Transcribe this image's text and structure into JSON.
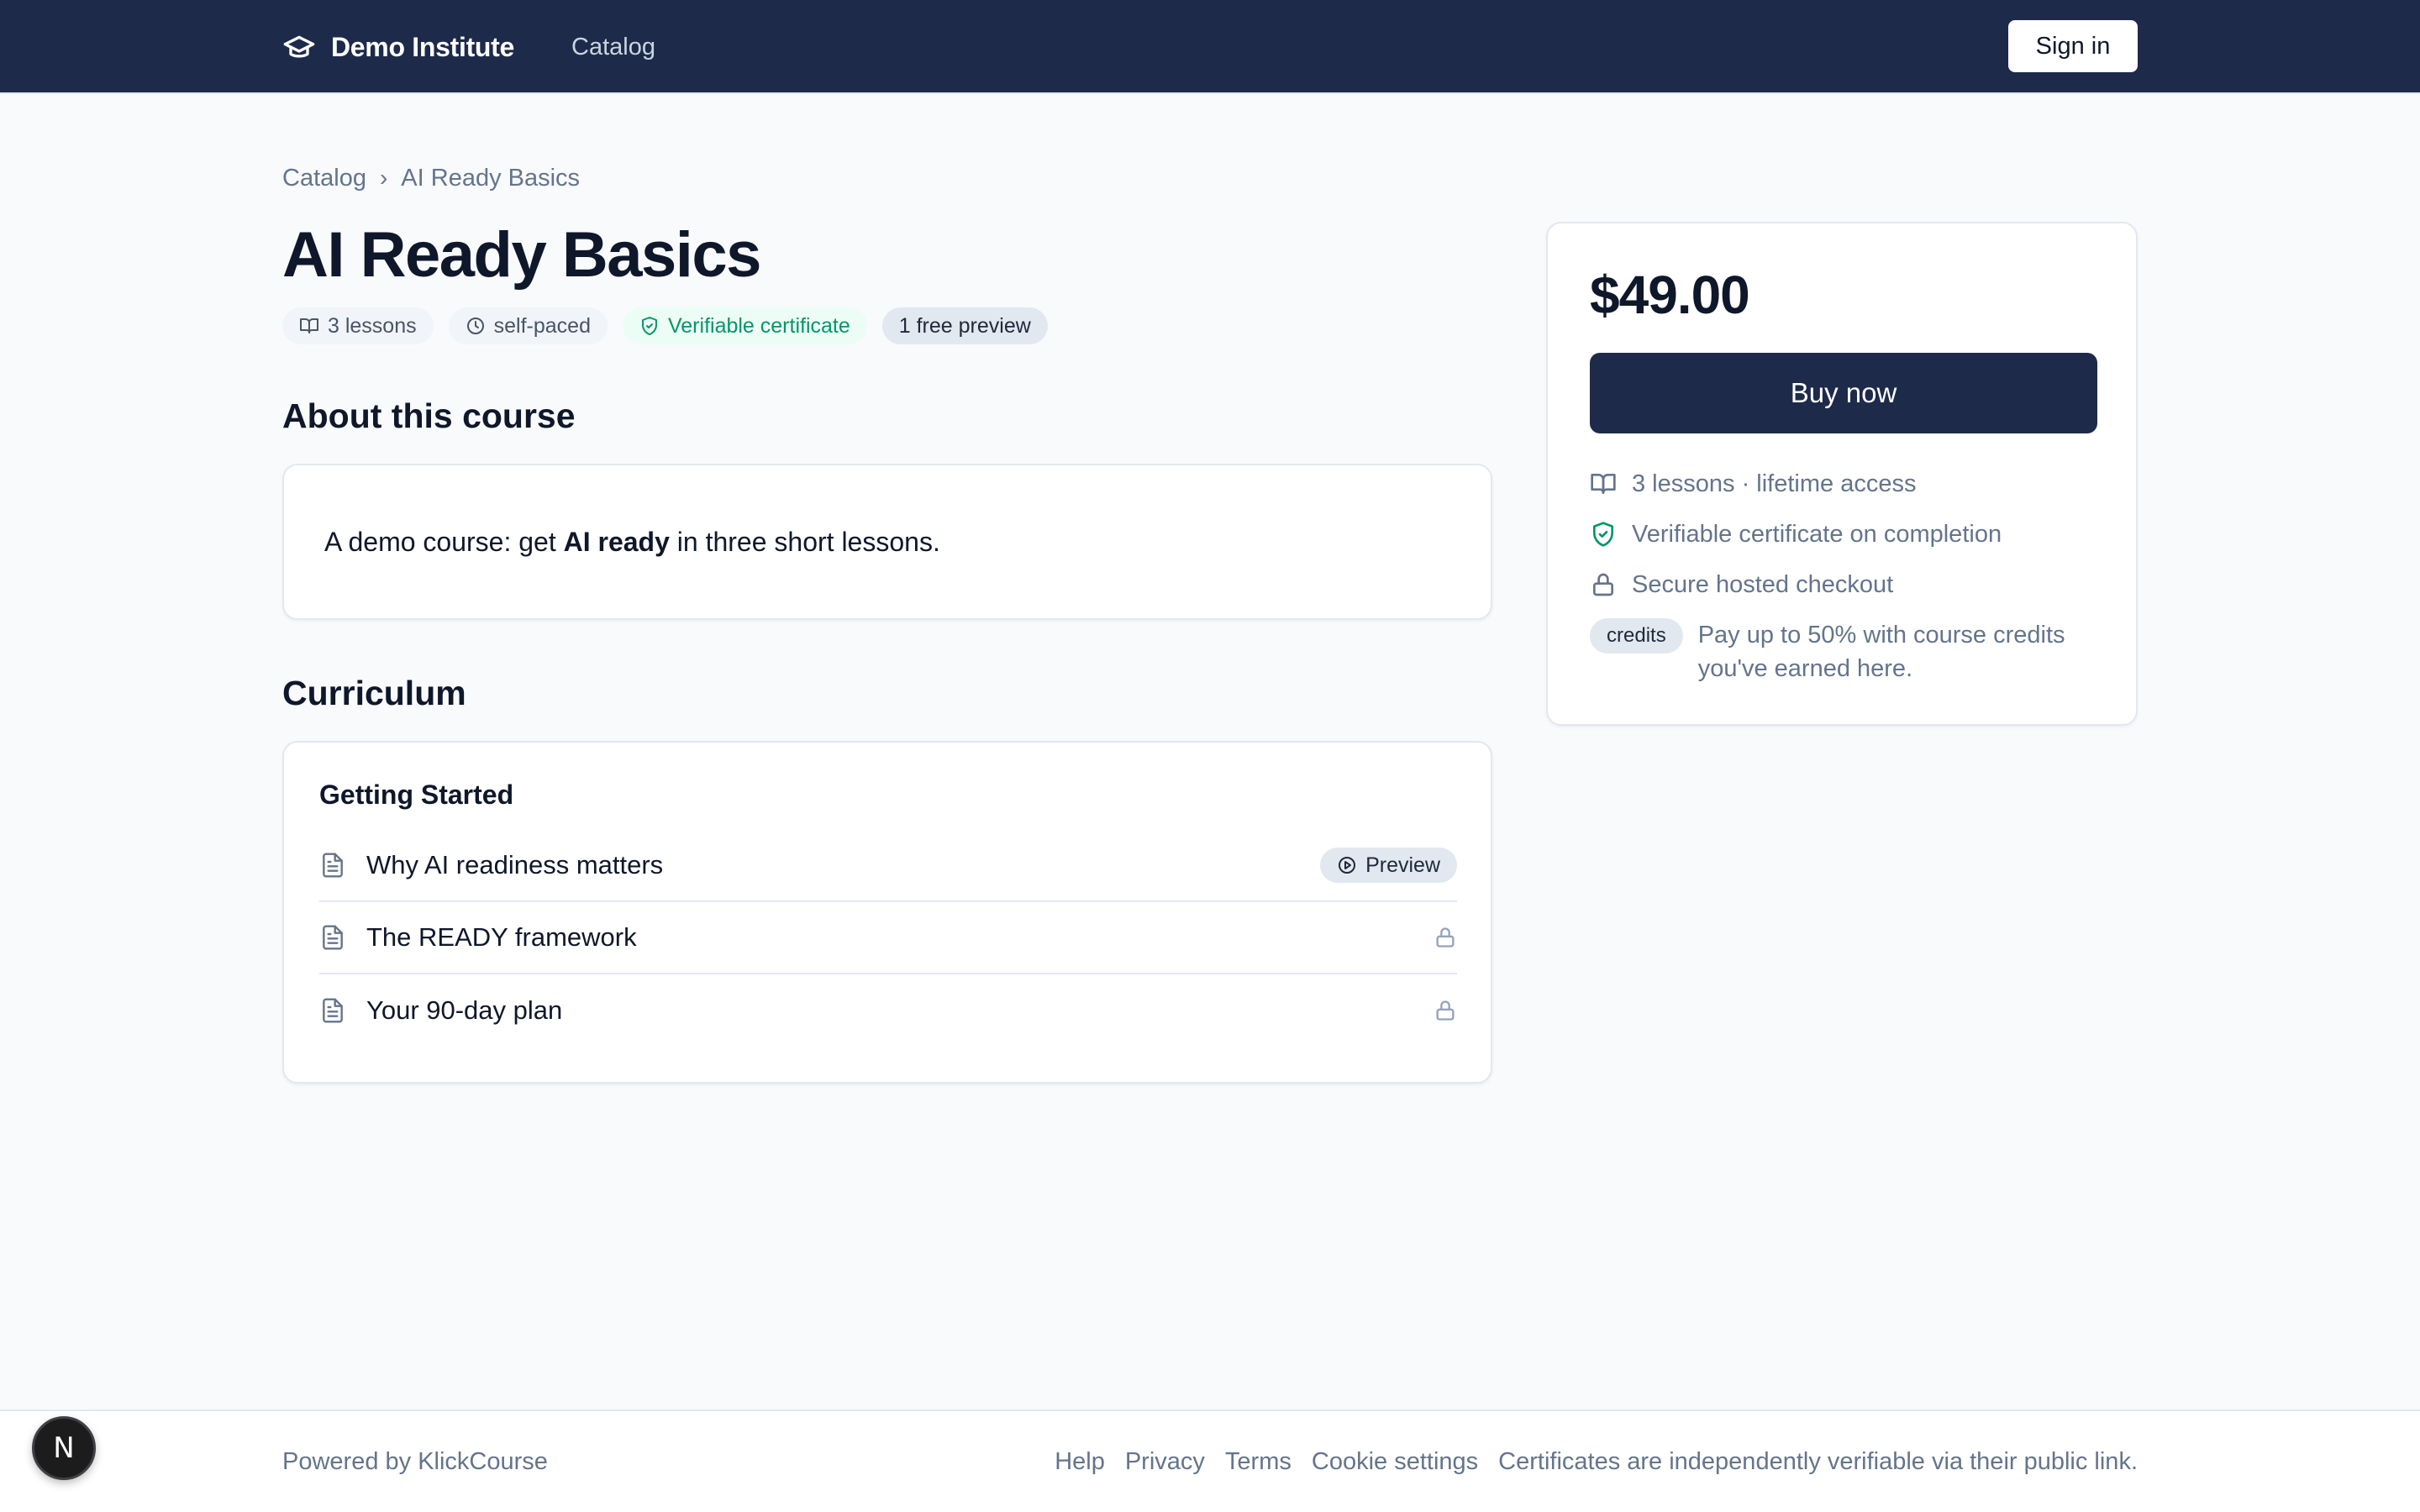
{
  "header": {
    "brand_name": "Demo Institute",
    "nav_catalog": "Catalog",
    "sign_in": "Sign in"
  },
  "breadcrumb": {
    "items": [
      "Catalog",
      "AI Ready Basics"
    ],
    "separator": "›"
  },
  "course": {
    "title": "AI Ready Basics",
    "chips": {
      "lessons": "3 lessons",
      "pace": "self-paced",
      "certificate": "Verifiable certificate",
      "preview": "1 free preview"
    }
  },
  "about": {
    "heading": "About this course",
    "text_before": "A demo course: get ",
    "text_bold": "AI ready",
    "text_after": " in three short lessons."
  },
  "curriculum": {
    "heading": "Curriculum",
    "module_title": "Getting Started",
    "lessons": [
      {
        "title": "Why AI readiness matters",
        "status": "Preview"
      },
      {
        "title": "The READY framework",
        "status": "locked"
      },
      {
        "title": "Your 90-day plan",
        "status": "locked"
      }
    ]
  },
  "purchase": {
    "price": "$49.00",
    "buy_label": "Buy now",
    "features": {
      "lessons": "3 lessons · lifetime access",
      "certificate": "Verifiable certificate on completion",
      "checkout": "Secure hosted checkout",
      "credits_tag": "credits",
      "credits_text": "Pay up to 50% with course credits you've earned here."
    }
  },
  "footer": {
    "powered_by": "Powered by KlickCourse",
    "links": [
      "Help",
      "Privacy",
      "Terms",
      "Cookie settings"
    ],
    "note": "Certificates are independently verifiable via their public link."
  },
  "dev_badge": "N",
  "colors": {
    "navbar": "#1e2a4a",
    "accent_green": "#059669",
    "background": "#f8fafc"
  }
}
